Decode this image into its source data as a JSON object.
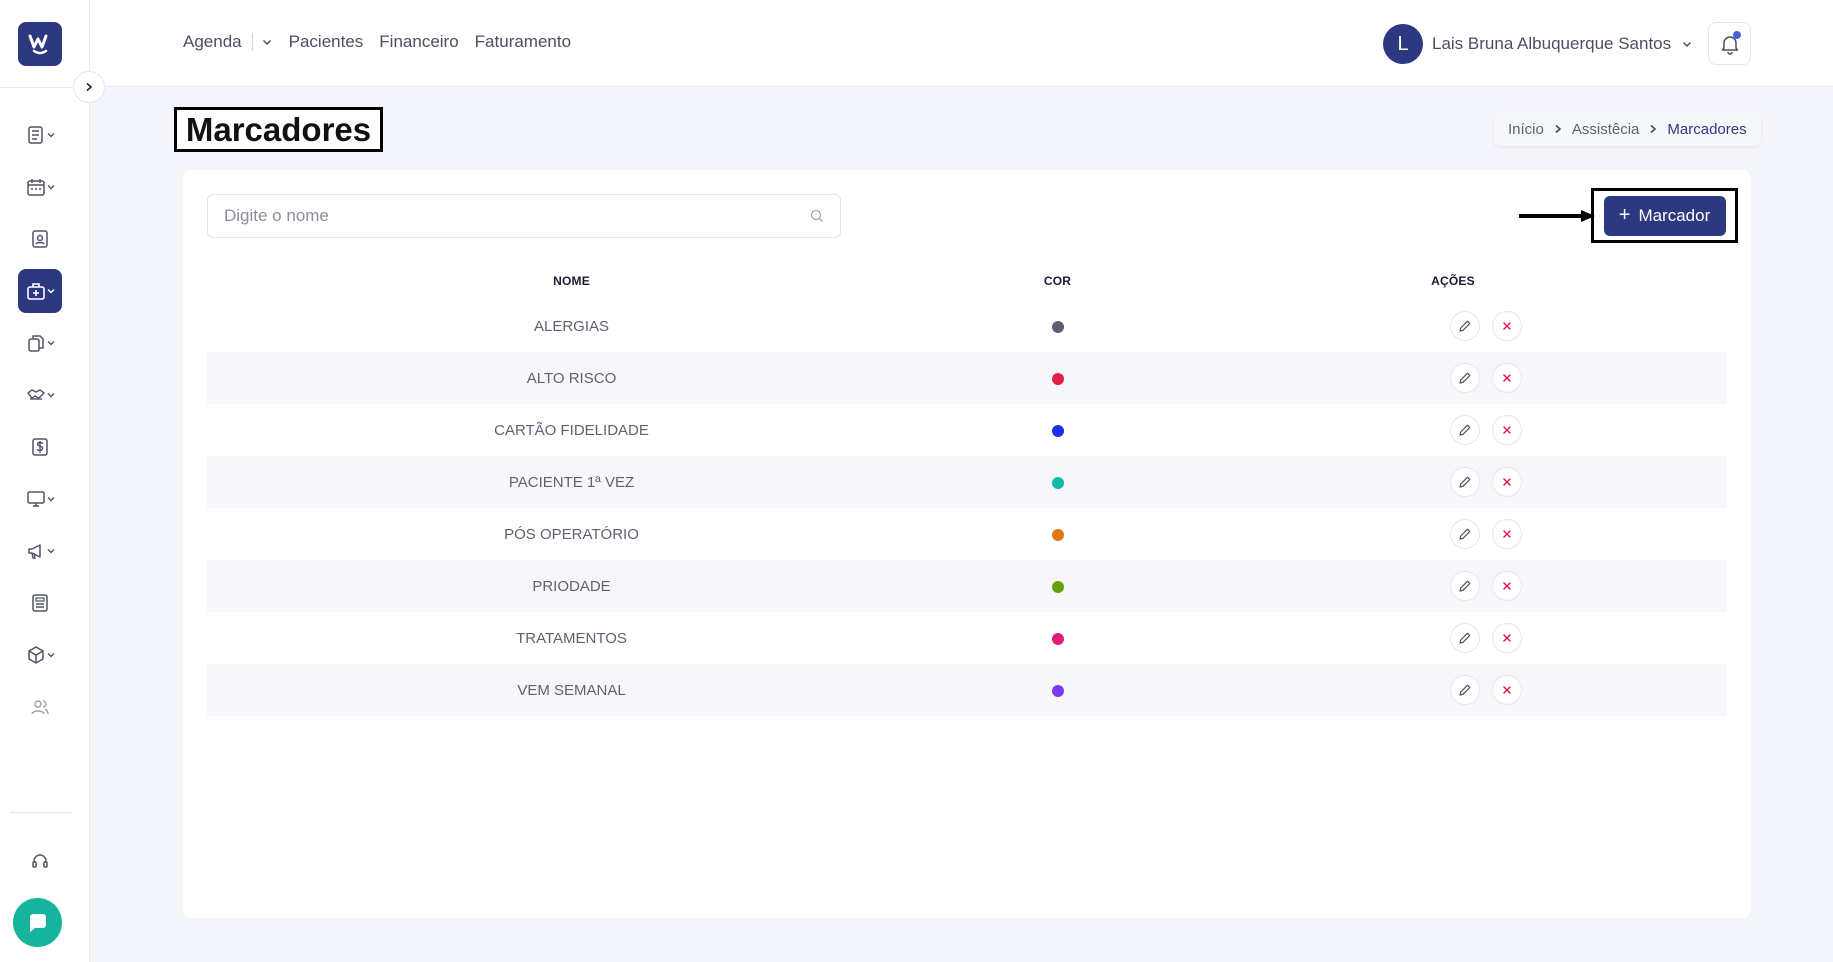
{
  "logo": {
    "text": "W"
  },
  "nav": {
    "agenda": "Agenda",
    "pacientes": "Pacientes",
    "financeiro": "Financeiro",
    "faturamento": "Faturamento"
  },
  "user": {
    "initial": "L",
    "name": "Lais Bruna Albuquerque Santos"
  },
  "page": {
    "title": "Marcadores"
  },
  "breadcrumb": {
    "inicio": "Início",
    "assistencia": "Assistêcia",
    "current": "Marcadores"
  },
  "search": {
    "placeholder": "Digite o nome",
    "value": ""
  },
  "add_button": {
    "plus": "+",
    "label": "Marcador"
  },
  "table": {
    "headers": {
      "nome": "NOME",
      "cor": "COR",
      "acoes": "AÇÕES"
    },
    "rows": [
      {
        "name": "ALERGIAS",
        "color": "#5b5f73"
      },
      {
        "name": "ALTO RISCO",
        "color": "#e11d48"
      },
      {
        "name": "CARTÃO FIDELIDADE",
        "color": "#1d2ee8"
      },
      {
        "name": "PACIENTE 1ª VEZ",
        "color": "#14b8a6"
      },
      {
        "name": "PÓS OPERATÓRIO",
        "color": "#e27712"
      },
      {
        "name": "PRIODADE",
        "color": "#65a30d"
      },
      {
        "name": "TRATAMENTOS",
        "color": "#e11d74"
      },
      {
        "name": "VEM SEMANAL",
        "color": "#7c3aed"
      }
    ]
  },
  "colors": {
    "primary": "#2c3880",
    "danger": "#e11d48",
    "chat": "#17b49d"
  }
}
